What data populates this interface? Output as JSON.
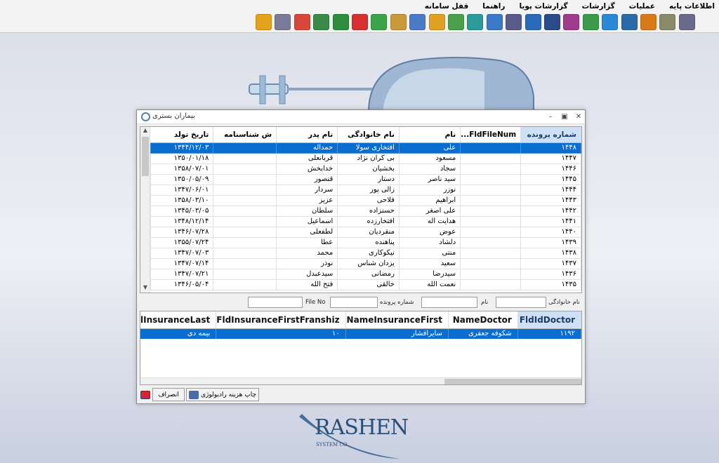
{
  "menu": [
    "اطلاعات پایه",
    "عملیات",
    "گزارشات",
    "گزارشات پویا",
    "راهنما",
    "قفل سامانه"
  ],
  "toolbar": [
    {
      "name": "report-icon",
      "color": "#e5a21c"
    },
    {
      "name": "document-s-icon",
      "color": "#7a7a9a"
    },
    {
      "name": "certificate-icon",
      "color": "#d8483a"
    },
    {
      "name": "excel-icon",
      "color": "#3c8a4a"
    },
    {
      "name": "document-check-icon",
      "color": "#2f8e3c"
    },
    {
      "name": "document-red-icon",
      "color": "#d83030"
    },
    {
      "name": "document-green-icon",
      "color": "#3ba34a"
    },
    {
      "name": "search-doc-icon",
      "color": "#c89a3a"
    },
    {
      "name": "search-list-icon",
      "color": "#4a7ac8"
    },
    {
      "name": "checklist-icon",
      "color": "#e0a020"
    },
    {
      "name": "users-icon",
      "color": "#4aa04a"
    },
    {
      "name": "globe-icon",
      "color": "#2a9a9a"
    },
    {
      "name": "id-card-icon",
      "color": "#3a78c8"
    },
    {
      "name": "printer-icon",
      "color": "#5a5a8a"
    },
    {
      "name": "crane-icon",
      "color": "#2a6ab8"
    },
    {
      "name": "building-icon",
      "color": "#2a4a8a"
    },
    {
      "name": "users-group-icon",
      "color": "#a03a8a"
    },
    {
      "name": "truck-icon",
      "color": "#3a9a4a"
    },
    {
      "name": "box-icon",
      "color": "#2a88d8"
    },
    {
      "name": "gear-icon",
      "color": "#2a6aa8"
    },
    {
      "name": "wrench-icon",
      "color": "#d87a1a"
    },
    {
      "name": "settings-doc-icon",
      "color": "#8a8a6a"
    },
    {
      "name": "window-settings-icon",
      "color": "#6a6a8a"
    }
  ],
  "window": {
    "title": "بیماران بستری",
    "columns": [
      "شماره پرونده",
      "FldFileNum...",
      "نام",
      "نام خانوادگی",
      "نام پدر",
      "ش شناسنامه",
      "تاریخ تولد"
    ],
    "rows": [
      [
        "۱۴۴۸",
        "",
        "علی",
        "افتخاری سولا",
        "حمداله",
        "",
        "۱۳۴۴/۱۲/۰۳"
      ],
      [
        "۱۴۴۷",
        "",
        "مسعود",
        "بی کران نژاد",
        "قربانعلی",
        "",
        "۱۳۵۰/۰۱/۱۸"
      ],
      [
        "۱۴۴۶",
        "",
        "سجاد",
        "بخشیان",
        "خدابخش",
        "",
        "۱۳۵۸/۰۷/۰۱"
      ],
      [
        "۱۴۴۵",
        "",
        "سید ناصر",
        "دستار",
        "قنصور",
        "",
        "۱۳۵۰/۰۵/۰۹"
      ],
      [
        "۱۴۴۴",
        "",
        "نوزر",
        "زالی پور",
        "سردار",
        "",
        "۱۳۴۷/۰۶/۰۱"
      ],
      [
        "۱۴۴۳",
        "",
        "ابراهیم",
        "فلاحی",
        "عزیز",
        "",
        "۱۳۵۸/۰۳/۱۰"
      ],
      [
        "۱۴۴۲",
        "",
        "علی اصغر",
        "حسنزاده",
        "سلطان",
        "",
        "۱۳۴۵/۰۳/۰۵"
      ],
      [
        "۱۴۴۱",
        "",
        "هدایت اله",
        "افتخارزده",
        "اسماعیل",
        "",
        "۱۳۴۸/۱۲/۱۴"
      ],
      [
        "۱۴۴۰",
        "",
        "عوض",
        "منقردیان",
        "لطفعلی",
        "",
        "۱۳۴۶/۰۷/۲۸"
      ],
      [
        "۱۴۳۹",
        "",
        "دلشاد",
        "پناهنده",
        "عطا",
        "",
        "۱۳۵۵/۰۷/۲۴"
      ],
      [
        "۱۴۳۸",
        "",
        "منتی",
        "نیکوکاری",
        "محمد",
        "",
        "۱۳۴۷/۰۷/۰۳"
      ],
      [
        "۱۴۳۷",
        "",
        "سعید",
        "یزدان شناس",
        "نوذر",
        "",
        "۱۳۴۷/۰۷/۱۴"
      ],
      [
        "۱۴۳۶",
        "",
        "سیدرضا",
        "رمضانی",
        "سیدعبدل",
        "",
        "۱۳۴۷/۰۷/۲۱"
      ],
      [
        "۱۴۳۵",
        "",
        "نعمت الله",
        "خالقی",
        "فتح الله",
        "",
        "۱۳۴۶/۰۵/۰۴"
      ]
    ],
    "filters": {
      "last_name_label": "نام خانوادگی",
      "first_name_label": "نام",
      "file_number_label": "شماره پرونده",
      "file_no_label": "File No",
      "last_name_value": "",
      "first_name_value": "",
      "file_number_value": "",
      "file_no_value": ""
    },
    "columns2": [
      "FldIdDoctor",
      "NameDoctor",
      "NameInsuranceFirst",
      "FldInsuranceFirstFranshiz",
      "lInsuranceLast"
    ],
    "rows2": [
      [
        "۱۱۹۲",
        "شکوفه جعفری",
        "سایرافشار",
        "۱۰",
        "بیمه دی"
      ]
    ],
    "print_button": "چاپ هزینه رادیولوژی",
    "cancel_button": "انصراف"
  },
  "logo": {
    "big": "RASHEN",
    "small": "SYSTEM CO."
  }
}
